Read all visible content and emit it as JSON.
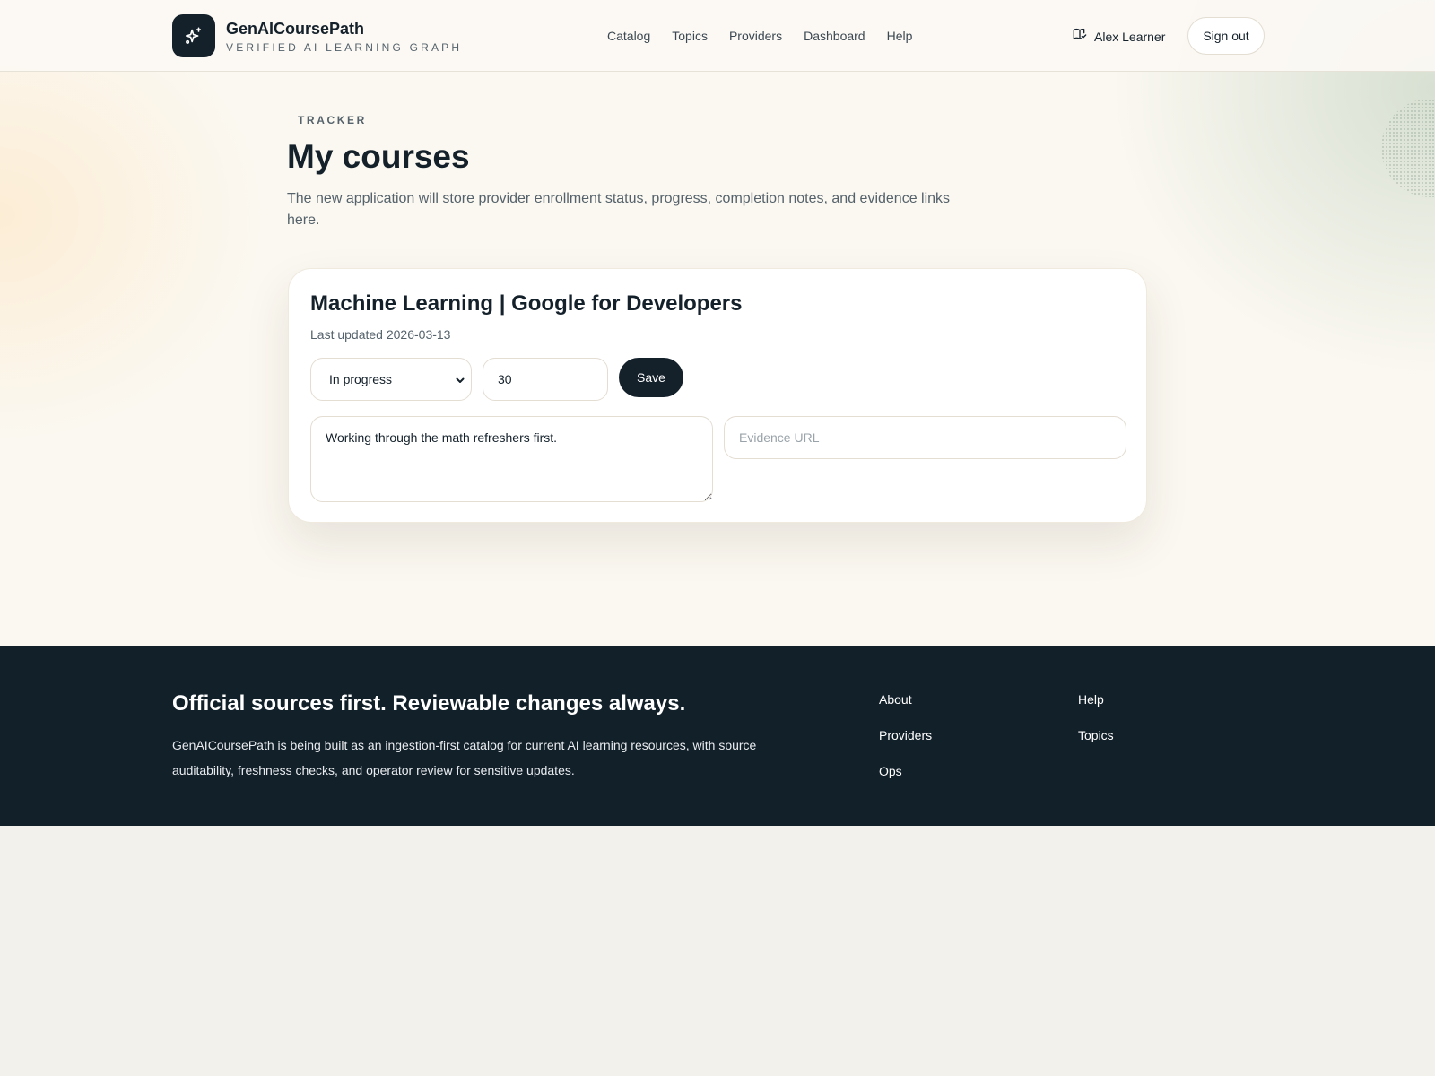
{
  "brand": {
    "name": "GenAICoursePath",
    "tagline": "VERIFIED AI LEARNING GRAPH",
    "logo_icon": "sparkles-icon"
  },
  "nav": {
    "items": [
      "Catalog",
      "Topics",
      "Providers",
      "Dashboard",
      "Help"
    ]
  },
  "user": {
    "name": "Alex Learner",
    "icon": "book-check-icon",
    "signout_label": "Sign out"
  },
  "page": {
    "eyebrow": "TRACKER",
    "title": "My courses",
    "description": "The new application will store provider enrollment status, progress, completion notes, and evidence links here."
  },
  "course": {
    "title": "Machine Learning | Google for Developers",
    "updated": "Last updated 2026-03-13",
    "status": "In progress",
    "progress": "30",
    "save_label": "Save",
    "notes": "Working through the math refreshers first.",
    "evidence_placeholder": "Evidence URL"
  },
  "footer": {
    "title": "Official sources first. Reviewable changes always.",
    "description": "GenAICoursePath is being built as an ingestion-first catalog for current AI learning resources, with source auditability, freshness checks, and operator review for sensitive updates.",
    "links_col1": [
      "About",
      "Providers",
      "Ops"
    ],
    "links_col2": [
      "Help",
      "Topics"
    ]
  },
  "colors": {
    "ink": "#14212b",
    "footer_bg": "#12202a",
    "muted": "#55626b"
  }
}
